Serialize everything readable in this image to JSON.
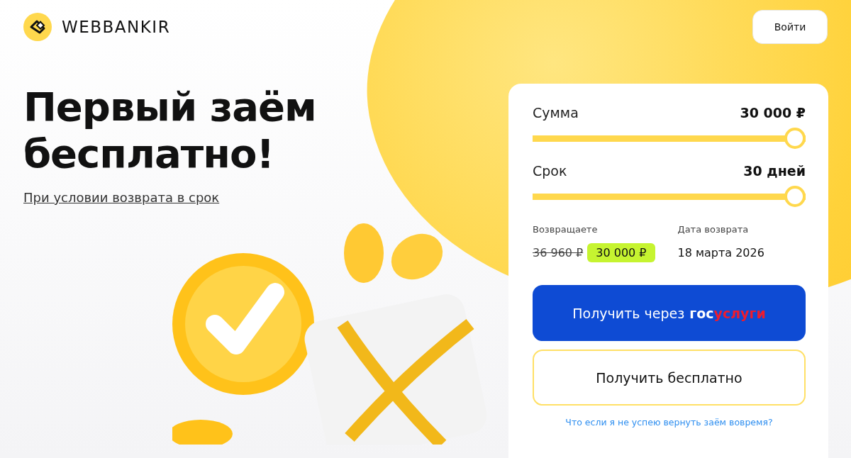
{
  "header": {
    "logo_text": "WEBBANKIR",
    "login_button": "Войти"
  },
  "hero": {
    "title": "Первый заём бесплатно!",
    "condition_link": "При условии возврата в срок"
  },
  "calculator": {
    "sliders": [
      {
        "label": "Сумма",
        "value": "30 000 ₽",
        "level": 1
      },
      {
        "label": "Срок",
        "value": "30 дней",
        "level": 1
      }
    ],
    "repay": {
      "label": "Возвращаете",
      "old_amount": "36 960 ₽",
      "amount": "30 000 ₽"
    },
    "return_date": {
      "label": "Дата возврата",
      "value": "18 марта 2026"
    },
    "gosuslugi_button": {
      "label": "Получить через",
      "logo_part_1": "гос",
      "logo_part_2": "услуги"
    },
    "free_button": "Получить бесплатно",
    "help_link": "Что если я не успею вернуть заём вовремя?"
  }
}
